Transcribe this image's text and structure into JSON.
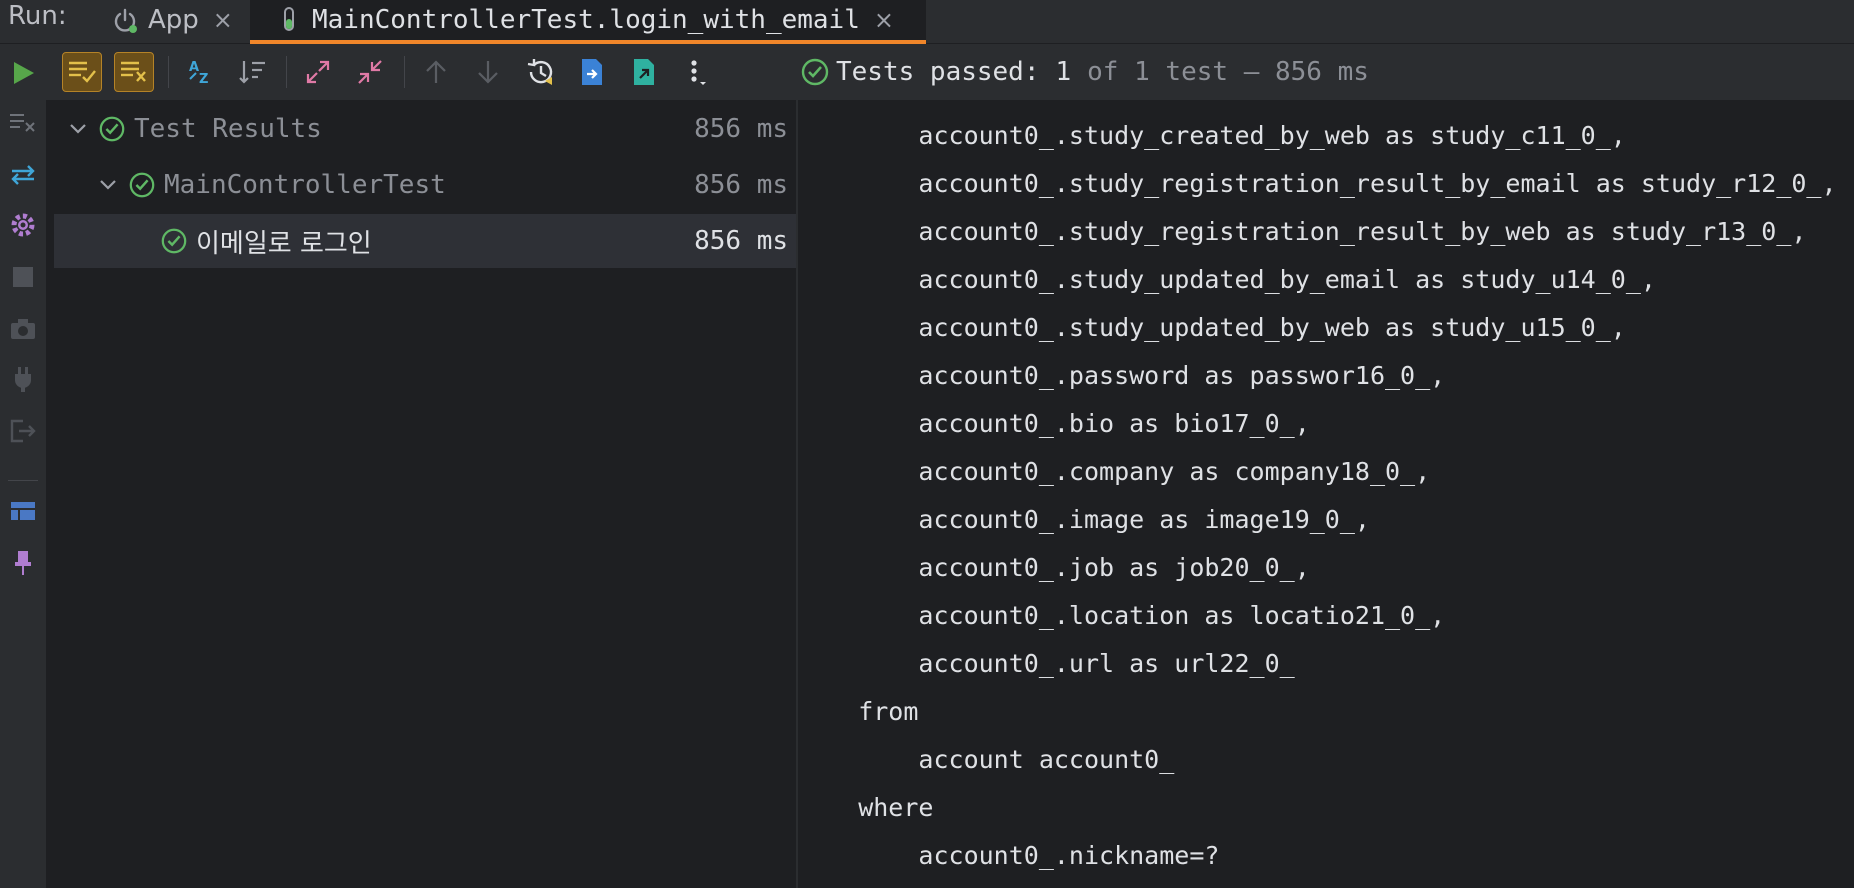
{
  "tabbar": {
    "run_label": "Run:",
    "tabs": [
      {
        "label": "App",
        "close": "×"
      },
      {
        "label": "MainControllerTest.login_with_email",
        "close": "×"
      }
    ]
  },
  "status": {
    "passed_label": "Tests passed:",
    "count": "1",
    "rest": "of 1 test – 856 ms"
  },
  "tree": {
    "rows": [
      {
        "label": "Test Results",
        "time": "856 ms",
        "status": "passed",
        "expanded": true
      },
      {
        "label": "MainControllerTest",
        "time": "856 ms",
        "status": "passed",
        "expanded": true
      },
      {
        "label": "이메일로 로그인",
        "time": "856 ms",
        "status": "passed",
        "selected": true
      }
    ]
  },
  "console": {
    "lines": [
      "        account0_.study_created_by_web as study_c11_0_,",
      "        account0_.study_registration_result_by_email as study_r12_0_,",
      "        account0_.study_registration_result_by_web as study_r13_0_,",
      "        account0_.study_updated_by_email as study_u14_0_,",
      "        account0_.study_updated_by_web as study_u15_0_,",
      "        account0_.password as passwor16_0_,",
      "        account0_.bio as bio17_0_,",
      "        account0_.company as company18_0_,",
      "        account0_.image as image19_0_,",
      "        account0_.job as job20_0_,",
      "        account0_.location as locatio21_0_,",
      "        account0_.url as url22_0_",
      "    from",
      "        account account0_",
      "    where",
      "        account0_.nickname=?"
    ]
  },
  "colors": {
    "accent_tab": "#f0862a",
    "pass_green": "#5fb865",
    "run_green": "#57a64a"
  }
}
